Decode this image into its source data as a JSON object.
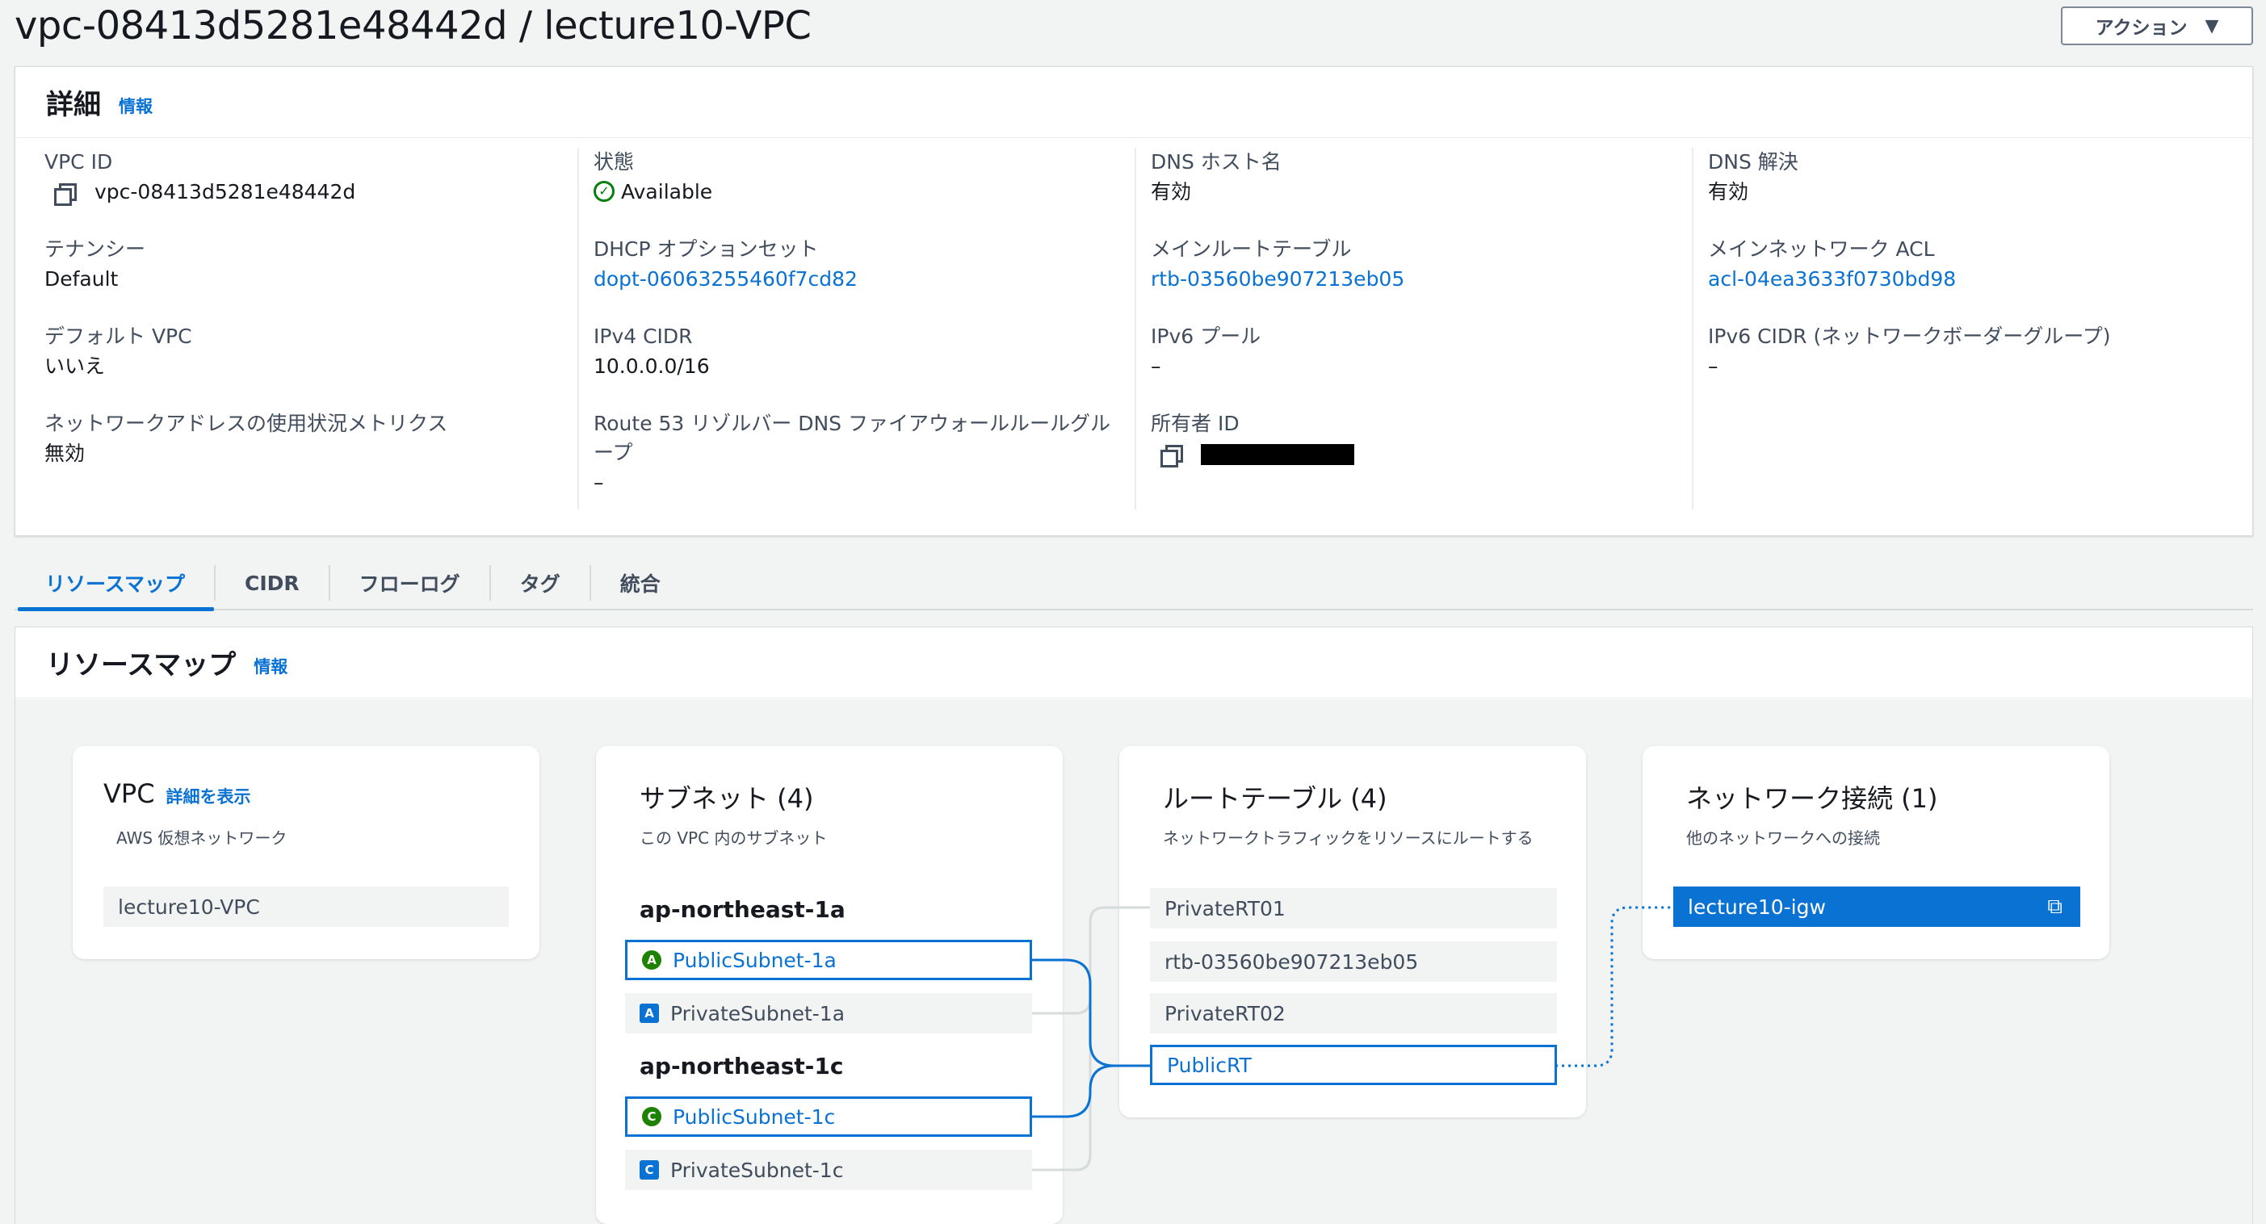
{
  "header": {
    "title": "vpc-08413d5281e48442d / lecture10-VPC",
    "actions_label": "アクション",
    "actions_icon": "caret-down-icon"
  },
  "details": {
    "title": "詳細",
    "info": "情報",
    "columns": [
      [
        {
          "label": "VPC ID",
          "value": "vpc-08413d5281e48442d"
        },
        {
          "label": "テナンシー",
          "value": "Default"
        },
        {
          "label": "デフォルト VPC",
          "value": "いいえ"
        },
        {
          "label": "ネットワークアドレスの使用状況メトリクス",
          "value": "無効"
        }
      ],
      [
        {
          "label": "状態",
          "value": "Available"
        },
        {
          "label": "DHCP オプションセット",
          "value": "dopt-06063255460f7cd82"
        },
        {
          "label": "IPv4 CIDR",
          "value": "10.0.0.0/16"
        },
        {
          "label": "Route 53 リゾルバー DNS ファイアウォールルールグル",
          "label2": "ープ",
          "value": "–"
        }
      ],
      [
        {
          "label": "DNS ホスト名",
          "value": "有効"
        },
        {
          "label": "メインルートテーブル",
          "value": "rtb-03560be907213eb05"
        },
        {
          "label": "IPv6 プール",
          "value": "–"
        },
        {
          "label": "所有者 ID",
          "value": ""
        }
      ],
      [
        {
          "label": "DNS 解決",
          "value": "有効"
        },
        {
          "label": "メインネットワーク ACL",
          "value": "acl-04ea3633f0730bd98"
        },
        {
          "label": "IPv6 CIDR (ネットワークボーダーグループ)",
          "value": "–"
        }
      ]
    ]
  },
  "tabs": [
    "リソースマップ",
    "CIDR",
    "フローログ",
    "タグ",
    "統合"
  ],
  "resource_map": {
    "title": "リソースマップ",
    "info": "情報",
    "vpc_card": {
      "title": "VPC",
      "link": "詳細を表示",
      "subtitle": "AWS 仮想ネットワーク",
      "item": "lecture10-VPC"
    },
    "subnet_card": {
      "title": "サブネット (4)",
      "subtitle": "この VPC 内のサブネット",
      "zones": [
        {
          "name": "ap-northeast-1a",
          "subnets": [
            {
              "badge": "A",
              "name": "PublicSubnet-1a"
            },
            {
              "badge": "A",
              "name": "PrivateSubnet-1a"
            }
          ]
        },
        {
          "name": "ap-northeast-1c",
          "subnets": [
            {
              "badge": "C",
              "name": "PublicSubnet-1c"
            },
            {
              "badge": "C",
              "name": "PrivateSubnet-1c"
            }
          ]
        }
      ]
    },
    "rt_card": {
      "title": "ルートテーブル (4)",
      "subtitle": "ネットワークトラフィックをリソースにルートする",
      "items": [
        "PrivateRT01",
        "rtb-03560be907213eb05",
        "PrivateRT02",
        "PublicRT"
      ]
    },
    "net_card": {
      "title": "ネットワーク接続 (1)",
      "subtitle": "他のネットワークへの接続",
      "items": [
        "lecture10-igw"
      ],
      "item_icon": "external-link-icon"
    }
  },
  "colors": {
    "link": "#0972d3",
    "available": "#037f0c",
    "az_green": "#1d8102"
  }
}
